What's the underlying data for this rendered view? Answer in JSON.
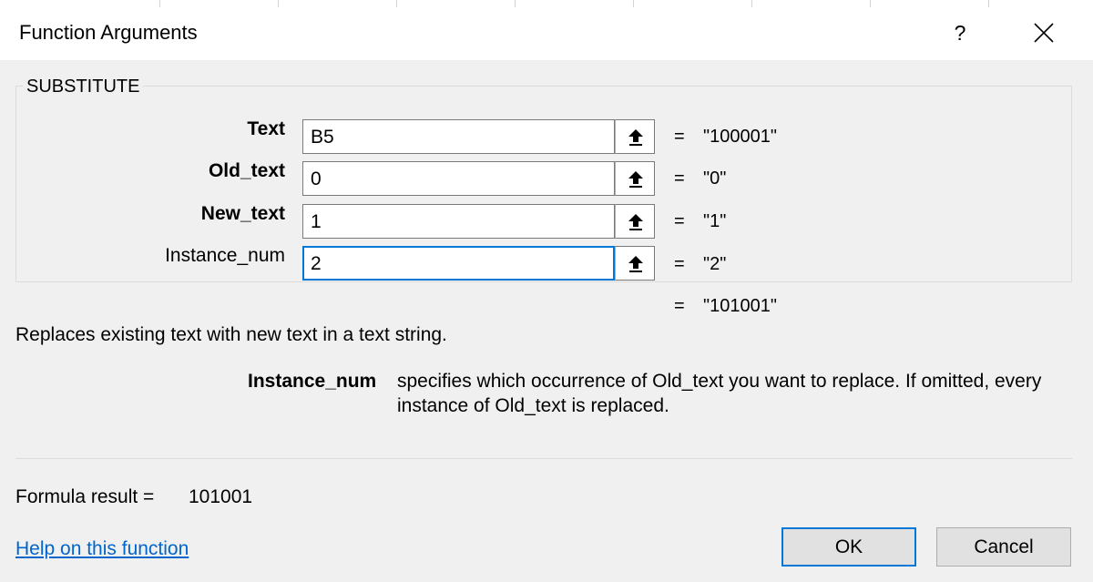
{
  "dialog": {
    "title": "Function Arguments",
    "help_glyph": "?",
    "function_name": "SUBSTITUTE"
  },
  "arguments": [
    {
      "label": "Text",
      "value": "B5",
      "result": "\"100001\""
    },
    {
      "label": "Old_text",
      "value": "0",
      "result": "\"0\""
    },
    {
      "label": "New_text",
      "value": "1",
      "result": "\"1\""
    },
    {
      "label": "Instance_num",
      "value": "2",
      "result": "\"2\""
    }
  ],
  "equals_sign": "=",
  "function_result": "\"101001\"",
  "description": "Replaces existing text with new text in a text string.",
  "arg_help": {
    "name": "Instance_num",
    "text": "specifies which occurrence of Old_text you want to replace. If omitted, every instance of Old_text is replaced."
  },
  "formula": {
    "label": "Formula result =",
    "value": "101001"
  },
  "help_link": "Help on this function",
  "buttons": {
    "ok": "OK",
    "cancel": "Cancel"
  },
  "icons": {
    "close": "close-icon",
    "collapse": "collapse-dialog-icon"
  },
  "colors": {
    "accent": "#0078d7",
    "link": "#0066cc",
    "dialog_bg": "#f0f0f0"
  }
}
